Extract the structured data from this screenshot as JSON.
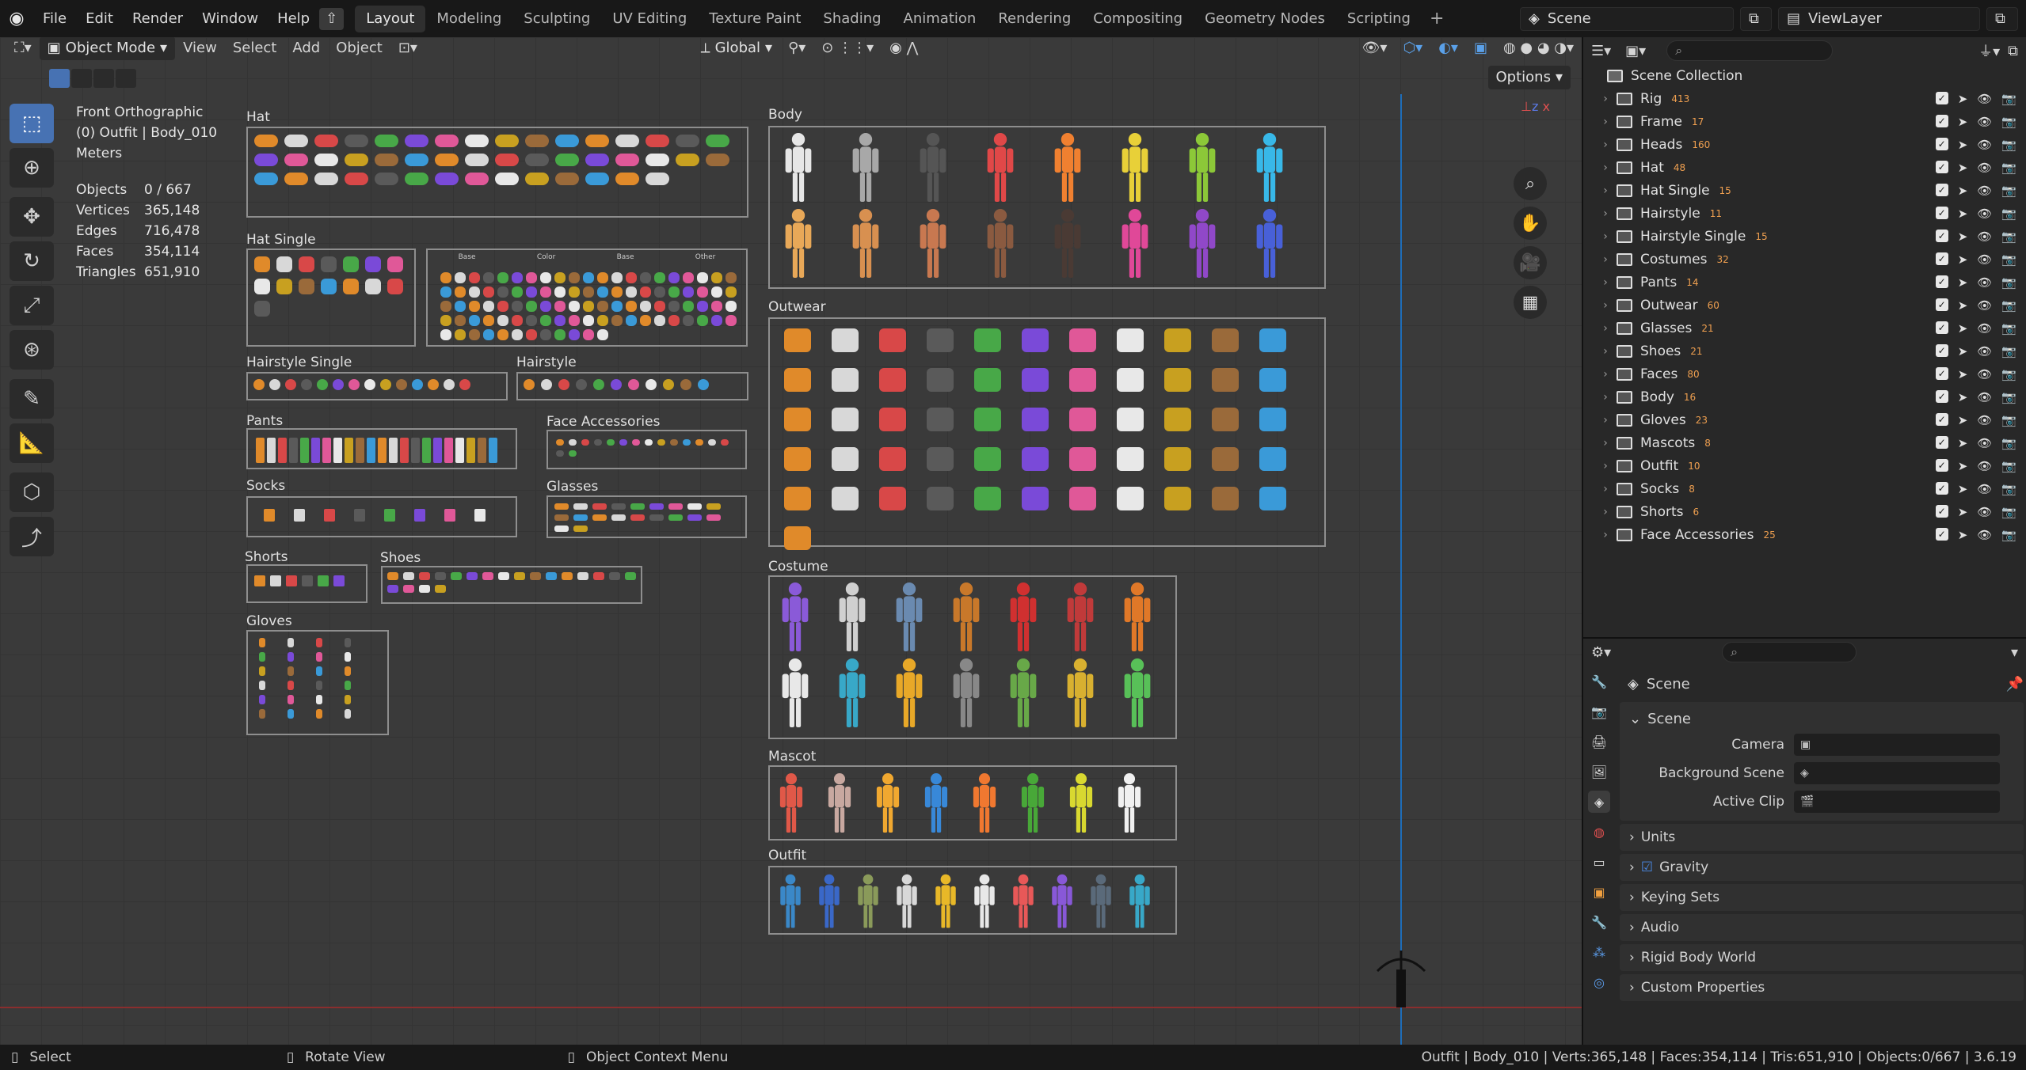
{
  "menu": {
    "file": "File",
    "edit": "Edit",
    "render": "Render",
    "window": "Window",
    "help": "Help"
  },
  "workspaces": [
    "Layout",
    "Modeling",
    "Sculpting",
    "UV Editing",
    "Texture Paint",
    "Shading",
    "Animation",
    "Rendering",
    "Compositing",
    "Geometry Nodes",
    "Scripting"
  ],
  "active_workspace": "Layout",
  "scene_name": "Scene",
  "view_layer": "ViewLayer",
  "viewport": {
    "mode": "Object Mode",
    "view": "View",
    "select": "Select",
    "add": "Add",
    "object": "Object",
    "orientation": "Global",
    "options": "Options",
    "overlay_title": "Front Orthographic",
    "overlay_context": "(0) Outfit | Body_010",
    "overlay_units": "Meters",
    "stats": [
      {
        "k": "Objects",
        "v": "0 / 667"
      },
      {
        "k": "Vertices",
        "v": "365,148"
      },
      {
        "k": "Edges",
        "v": "716,478"
      },
      {
        "k": "Faces",
        "v": "354,114"
      },
      {
        "k": "Triangles",
        "v": "651,910"
      }
    ],
    "groups": {
      "hat": "Hat",
      "hat_single": "Hat Single",
      "hairstyle_single": "Hairstyle Single",
      "hairstyle": "Hairstyle",
      "pants": "Pants",
      "face_accessories": "Face Accessories",
      "socks": "Socks",
      "glasses": "Glasses",
      "shorts": "Shorts",
      "shoes": "Shoes",
      "gloves": "Gloves",
      "body": "Body",
      "outwear": "Outwear",
      "costume": "Costume",
      "mascot": "Mascot",
      "outfit": "Outfit"
    },
    "hat_single_headers": [
      "Base",
      "Color",
      "Base",
      "Other"
    ],
    "body_colors": [
      "#e6e6e6",
      "#a8a8a8",
      "#555555",
      "#e04848",
      "#f08030",
      "#e8d038",
      "#8cc838",
      "#38b8e8",
      "#e8a858",
      "#d89050",
      "#c87850",
      "#8a5a40",
      "#4a3a34",
      "#e04898",
      "#9048c8",
      "#4860d8"
    ],
    "costume_colors": [
      "#8a5ad8",
      "#d0d0d0",
      "#6a8ab0",
      "#c8782a",
      "#d03030",
      "#c03a3a",
      "#e07828",
      "#e8e8e8",
      "#38a8c8",
      "#e8a828",
      "#888888",
      "#68a848",
      "#d8b030",
      "#58c058"
    ],
    "mascot_colors": [
      "#e05848",
      "#c8a8a0",
      "#f0a830",
      "#3888d8",
      "#f07830",
      "#48a838",
      "#d8d830",
      "#f0f0f0"
    ],
    "outfit_colors": [
      "#3a88c8",
      "#3a68c8",
      "#8a9a5a",
      "#d8d8d8",
      "#e8b828",
      "#e8e8e8",
      "#e85858",
      "#8858d8",
      "#5a6a7a",
      "#38a8c8"
    ]
  },
  "outliner": {
    "search_placeholder": "",
    "root": "Scene Collection",
    "collections": [
      {
        "name": "Rig",
        "count": "413"
      },
      {
        "name": "Frame",
        "count": "17"
      },
      {
        "name": "Heads",
        "count": "160"
      },
      {
        "name": "Hat",
        "count": "48"
      },
      {
        "name": "Hat Single",
        "count": "15"
      },
      {
        "name": "Hairstyle",
        "count": "11"
      },
      {
        "name": "Hairstyle Single",
        "count": "15"
      },
      {
        "name": "Costumes",
        "count": "32"
      },
      {
        "name": "Pants",
        "count": "14"
      },
      {
        "name": "Outwear",
        "count": "60"
      },
      {
        "name": "Glasses",
        "count": "21"
      },
      {
        "name": "Shoes",
        "count": "21"
      },
      {
        "name": "Faces",
        "count": "80"
      },
      {
        "name": "Body",
        "count": "16"
      },
      {
        "name": "Gloves",
        "count": "23"
      },
      {
        "name": "Mascots",
        "count": "8"
      },
      {
        "name": "Outfit",
        "count": "10"
      },
      {
        "name": "Socks",
        "count": "8"
      },
      {
        "name": "Shorts",
        "count": "6"
      },
      {
        "name": "Face Accessories",
        "count": "25"
      }
    ]
  },
  "properties": {
    "title": "Scene",
    "panel_scene": "Scene",
    "camera": "Camera",
    "background_scene": "Background Scene",
    "active_clip": "Active Clip",
    "panels": [
      "Units",
      "Gravity",
      "Keying Sets",
      "Audio",
      "Rigid Body World",
      "Custom Properties"
    ]
  },
  "status": {
    "select": "Select",
    "rotate": "Rotate View",
    "context": "Object Context Menu",
    "info": "Outfit | Body_010 | Verts:365,148 | Faces:354,114 | Tris:651,910 | Objects:0/667 | 3.6.19"
  }
}
